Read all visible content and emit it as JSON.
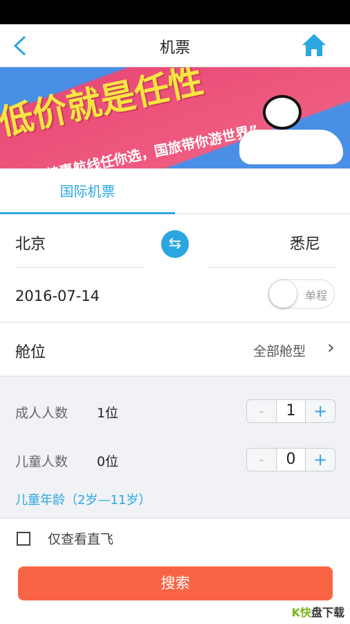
{
  "nav": {
    "title": "机票",
    "back_icon": "chevron-left-icon",
    "home_icon": "home-icon",
    "accent": "#2aa7e0"
  },
  "banner": {
    "headline": "低价就是任性",
    "slogan": "“特惠航线任你选，国旅带你游世界”"
  },
  "tabs": [
    {
      "label": "国际机票",
      "active": true
    }
  ],
  "route": {
    "from": "北京",
    "to": "悉尼",
    "swap_icon": "swap-arrows-icon"
  },
  "date": {
    "value": "2016-07-14",
    "trip_toggle_label": "单程",
    "round_trip": false
  },
  "cabin": {
    "label": "舱位",
    "value": "全部舱型"
  },
  "passengers": {
    "adult_label": "成人人数",
    "adult_value": "1位",
    "adult_count": "1",
    "child_label": "儿童人数",
    "child_value": "0位",
    "child_count": "0",
    "minus": "-",
    "plus": "+",
    "child_age_note": "儿童年龄（2岁—11岁）"
  },
  "direct": {
    "label": "仅查看直飞",
    "checked": false
  },
  "search": {
    "label": "搜索",
    "color": "#f96544"
  },
  "watermark": "快盘下载"
}
